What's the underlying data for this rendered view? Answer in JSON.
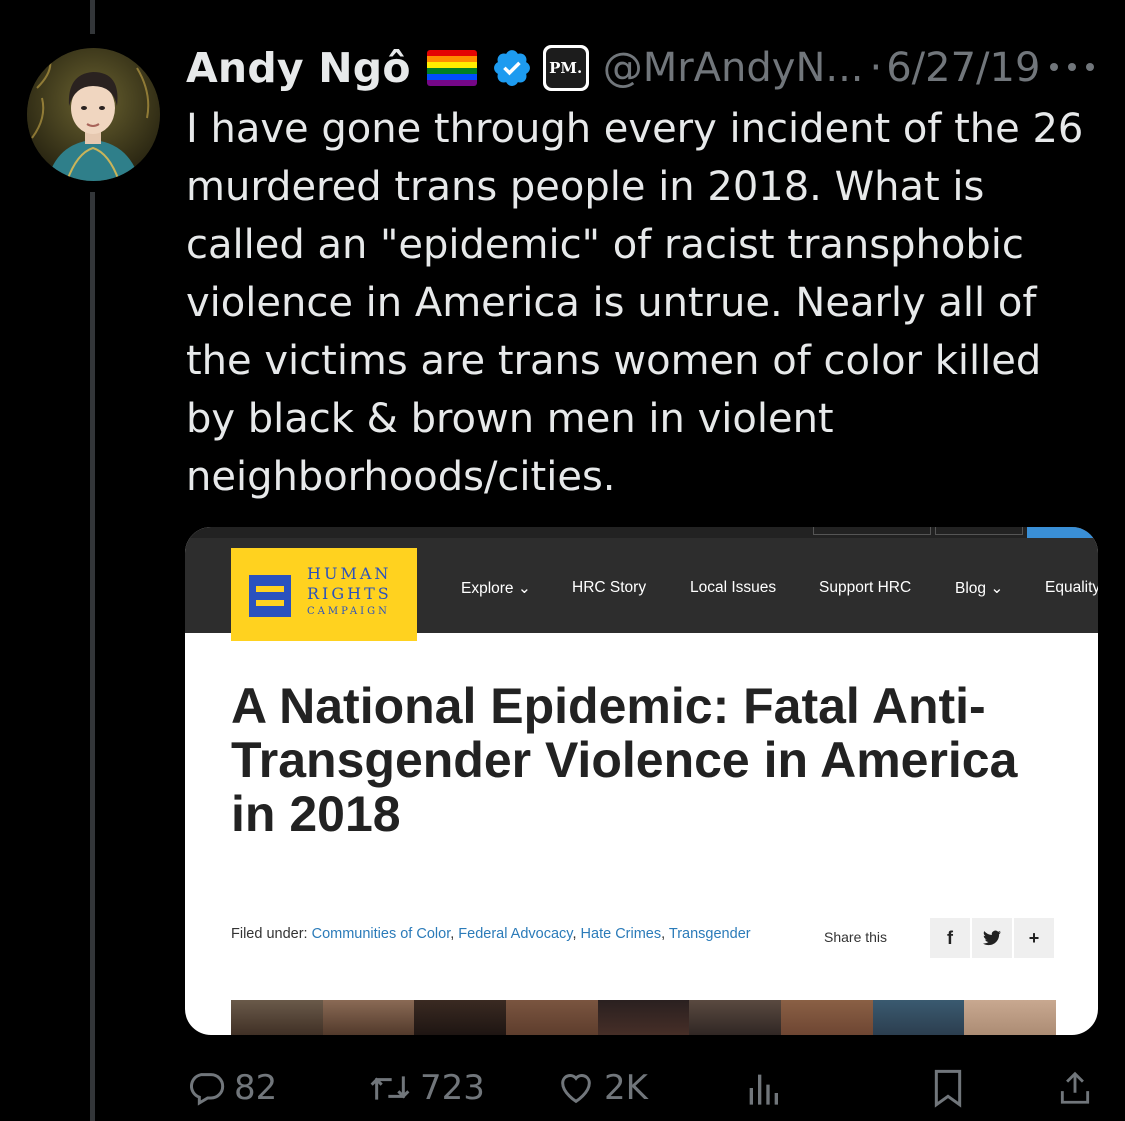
{
  "tweet": {
    "author_name": "Andy Ngô",
    "handle": "@MrAndyN...",
    "separator": "·",
    "date": "6/27/19",
    "affiliate_badge_text": "PM.",
    "text": "I have gone through every incident of the 26 murdered trans people in 2018. What is called an \"epidemic\" of racist transphobic violence in America is untrue. Nearly all of the victims are trans women of color killed by black & brown men in violent neighborhoods/cities.",
    "icons": {
      "flag": "pride-flag-icon",
      "verified": "verified-badge-icon",
      "more": "more-options-icon"
    }
  },
  "embedded_article": {
    "logo": {
      "line1": "HUMAN",
      "line2": "RIGHTS",
      "line3": "CAMPAIGN"
    },
    "nav": [
      "Explore",
      "HRC Story",
      "Local Issues",
      "Support HRC",
      "Blog",
      "Equality"
    ],
    "headline": "A National Epidemic: Fatal Anti-Transgender Violence in America in 2018",
    "filed_under_label": "Filed under:",
    "categories": [
      "Communities of Color",
      "Federal Advocacy",
      "Hate Crimes",
      "Transgender"
    ],
    "share_label": "Share this",
    "share_buttons": [
      "f",
      "",
      "+"
    ],
    "colors": {
      "logo_yellow": "#ffd21f",
      "logo_blue": "#2a52be",
      "link_blue": "#2b7bb9",
      "nav_bg": "#2d2d2d"
    }
  },
  "actions": {
    "replies": "82",
    "retweets": "723",
    "likes": "2K",
    "icons": [
      "reply-icon",
      "retweet-icon",
      "like-icon",
      "views-icon",
      "bookmark-icon",
      "share-icon"
    ]
  }
}
